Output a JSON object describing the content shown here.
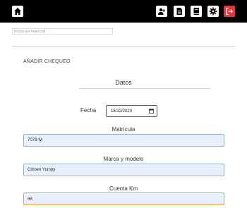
{
  "toolbar": {
    "icons": [
      "home-icon",
      "add-user-icon",
      "document-icon",
      "book-icon",
      "gear-icon",
      "logout-icon"
    ],
    "accent_logout": "#e8323c"
  },
  "search": {
    "placeholder": "Busca por matrícula"
  },
  "section": {
    "title": "AÑADIR CHEQUEO"
  },
  "form": {
    "heading": "Datos",
    "fecha_label": "Fecha",
    "fecha_value": "18/12/2020",
    "matricula_label": "Matrícula",
    "matricula_value": "7078-fyl",
    "marca_label": "Marca y modelo",
    "marca_value": "Citroen Yumpy",
    "km_label": "Cuenta Km",
    "km_value": "aa"
  }
}
